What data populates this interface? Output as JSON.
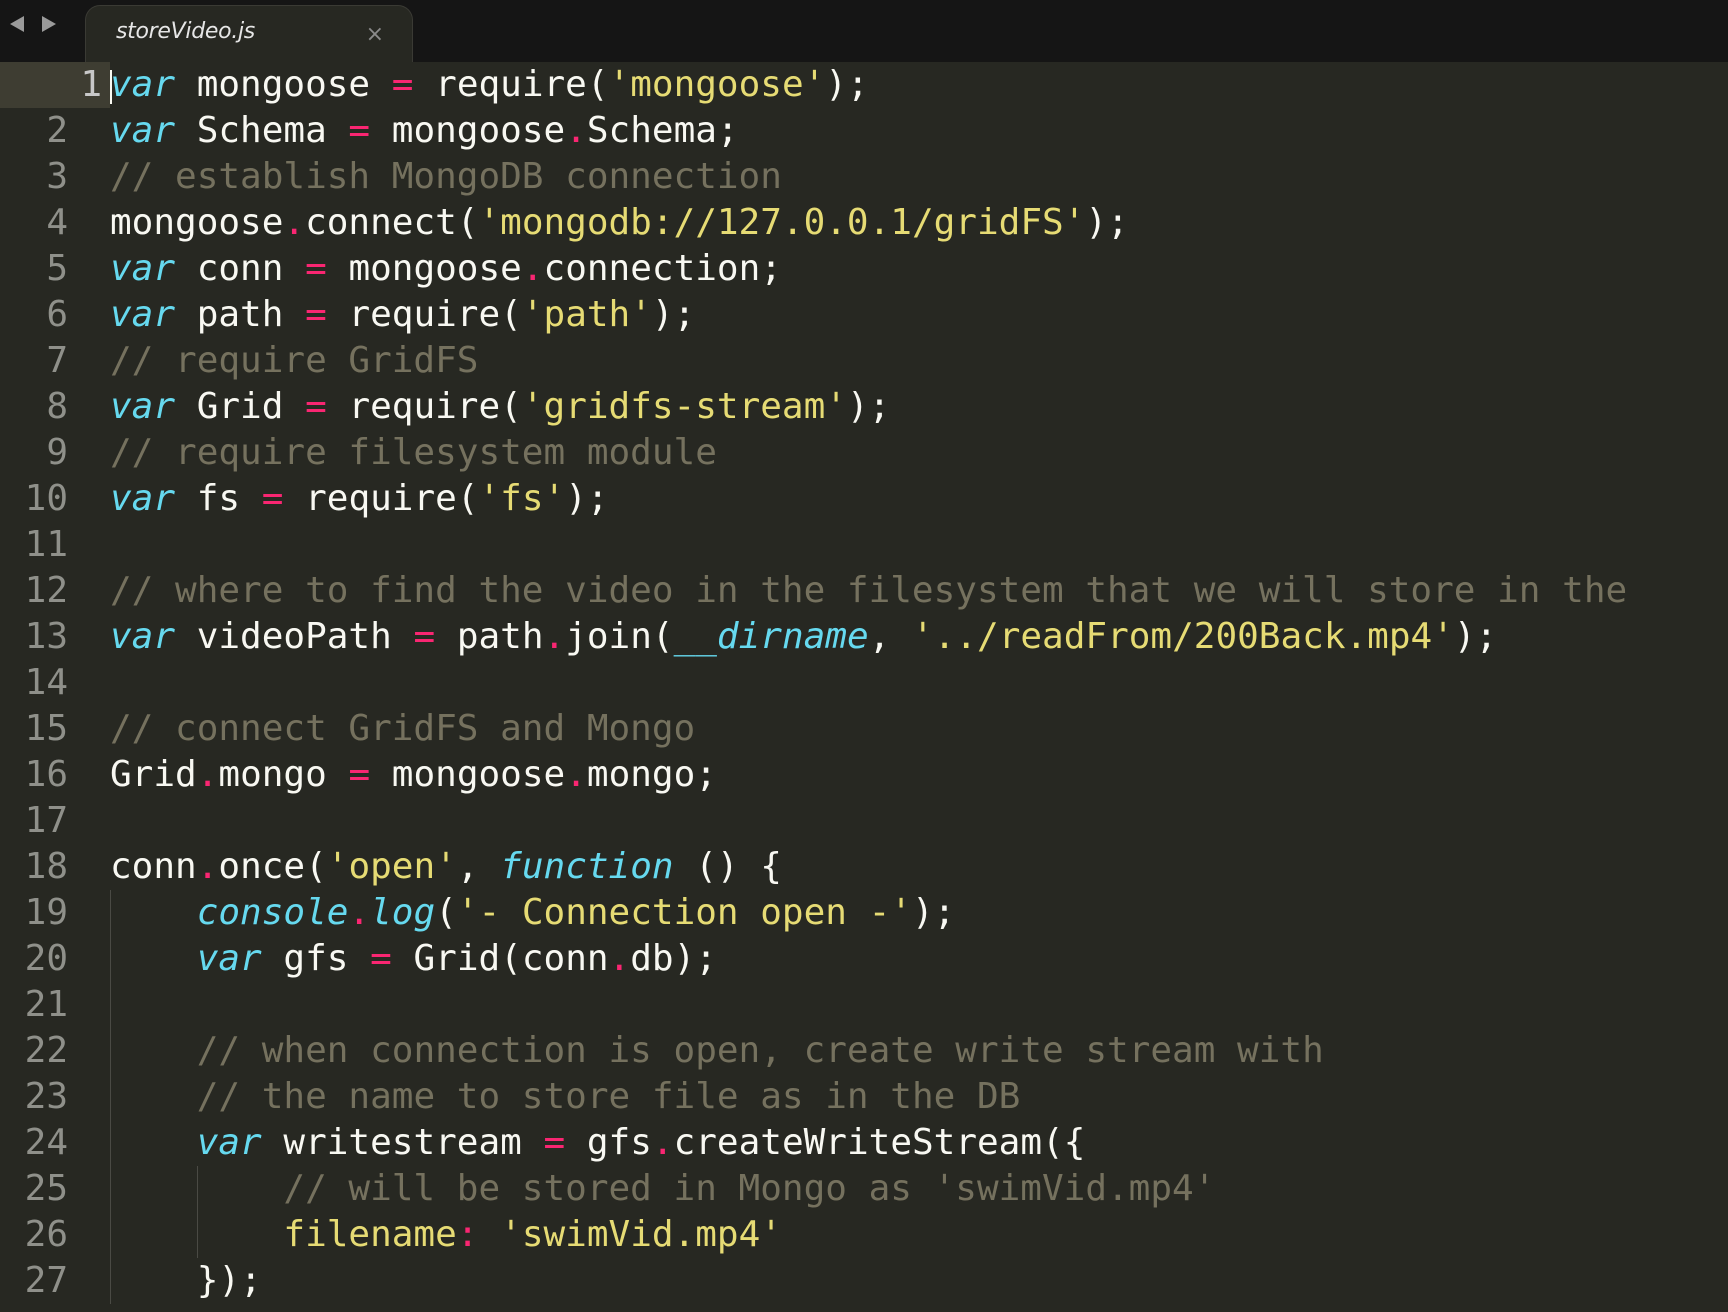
{
  "tabbar": {
    "active_tab": "storeVideo.js",
    "close_glyph": "×",
    "back_icon": "triangle-left",
    "forward_icon": "triangle-right"
  },
  "editor": {
    "current_line": 1,
    "line_numbers": [
      "1",
      "2",
      "3",
      "4",
      "5",
      "6",
      "7",
      "8",
      "9",
      "10",
      "11",
      "12",
      "13",
      "14",
      "15",
      "16",
      "17",
      "18",
      "19",
      "20",
      "21",
      "22",
      "23",
      "24",
      "25",
      "26",
      "27"
    ],
    "lines": [
      [
        {
          "t": "var",
          "c": "kw"
        },
        {
          "t": " mongoose ",
          "c": "txt"
        },
        {
          "t": "=",
          "c": "op"
        },
        {
          "t": " require(",
          "c": "txt"
        },
        {
          "t": "'mongoose'",
          "c": "str"
        },
        {
          "t": ");",
          "c": "txt"
        }
      ],
      [
        {
          "t": "var",
          "c": "kw"
        },
        {
          "t": " Schema ",
          "c": "txt"
        },
        {
          "t": "=",
          "c": "op"
        },
        {
          "t": " mongoose",
          "c": "txt"
        },
        {
          "t": ".",
          "c": "op"
        },
        {
          "t": "Schema;",
          "c": "txt"
        }
      ],
      [
        {
          "t": "// establish MongoDB connection",
          "c": "cmt"
        }
      ],
      [
        {
          "t": "mongoose",
          "c": "txt"
        },
        {
          "t": ".",
          "c": "op"
        },
        {
          "t": "connect(",
          "c": "txt"
        },
        {
          "t": "'mongodb://127.0.0.1/gridFS'",
          "c": "str"
        },
        {
          "t": ");",
          "c": "txt"
        }
      ],
      [
        {
          "t": "var",
          "c": "kw"
        },
        {
          "t": " conn ",
          "c": "txt"
        },
        {
          "t": "=",
          "c": "op"
        },
        {
          "t": " mongoose",
          "c": "txt"
        },
        {
          "t": ".",
          "c": "op"
        },
        {
          "t": "connection;",
          "c": "txt"
        }
      ],
      [
        {
          "t": "var",
          "c": "kw"
        },
        {
          "t": " path ",
          "c": "txt"
        },
        {
          "t": "=",
          "c": "op"
        },
        {
          "t": " require(",
          "c": "txt"
        },
        {
          "t": "'path'",
          "c": "str"
        },
        {
          "t": ");",
          "c": "txt"
        }
      ],
      [
        {
          "t": "// require GridFS",
          "c": "cmt"
        }
      ],
      [
        {
          "t": "var",
          "c": "kw"
        },
        {
          "t": " Grid ",
          "c": "txt"
        },
        {
          "t": "=",
          "c": "op"
        },
        {
          "t": " require(",
          "c": "txt"
        },
        {
          "t": "'gridfs-stream'",
          "c": "str"
        },
        {
          "t": ");",
          "c": "txt"
        }
      ],
      [
        {
          "t": "// require filesystem module",
          "c": "cmt"
        }
      ],
      [
        {
          "t": "var",
          "c": "kw"
        },
        {
          "t": " fs ",
          "c": "txt"
        },
        {
          "t": "=",
          "c": "op"
        },
        {
          "t": " require(",
          "c": "txt"
        },
        {
          "t": "'fs'",
          "c": "str"
        },
        {
          "t": ");",
          "c": "txt"
        }
      ],
      [],
      [
        {
          "t": "// where to find the video in the filesystem that we will store in the",
          "c": "cmt"
        }
      ],
      [
        {
          "t": "var",
          "c": "kw"
        },
        {
          "t": " videoPath ",
          "c": "txt"
        },
        {
          "t": "=",
          "c": "op"
        },
        {
          "t": " path",
          "c": "txt"
        },
        {
          "t": ".",
          "c": "op"
        },
        {
          "t": "join(",
          "c": "txt"
        },
        {
          "t": "__dirname",
          "c": "ital"
        },
        {
          "t": ", ",
          "c": "txt"
        },
        {
          "t": "'../readFrom/200Back.mp4'",
          "c": "str"
        },
        {
          "t": ");",
          "c": "txt"
        }
      ],
      [],
      [
        {
          "t": "// connect GridFS and Mongo",
          "c": "cmt"
        }
      ],
      [
        {
          "t": "Grid",
          "c": "txt"
        },
        {
          "t": ".",
          "c": "op"
        },
        {
          "t": "mongo ",
          "c": "txt"
        },
        {
          "t": "=",
          "c": "op"
        },
        {
          "t": " mongoose",
          "c": "txt"
        },
        {
          "t": ".",
          "c": "op"
        },
        {
          "t": "mongo;",
          "c": "txt"
        }
      ],
      [],
      [
        {
          "t": "conn",
          "c": "txt"
        },
        {
          "t": ".",
          "c": "op"
        },
        {
          "t": "once(",
          "c": "txt"
        },
        {
          "t": "'open'",
          "c": "str"
        },
        {
          "t": ", ",
          "c": "txt"
        },
        {
          "t": "function",
          "c": "kw"
        },
        {
          "t": " () {",
          "c": "txt"
        }
      ],
      [
        {
          "t": "    ",
          "c": "txt"
        },
        {
          "t": "console",
          "c": "ital"
        },
        {
          "t": ".",
          "c": "op"
        },
        {
          "t": "log",
          "c": "kw"
        },
        {
          "t": "(",
          "c": "txt"
        },
        {
          "t": "'- Connection open -'",
          "c": "str"
        },
        {
          "t": ");",
          "c": "txt"
        }
      ],
      [
        {
          "t": "    ",
          "c": "txt"
        },
        {
          "t": "var",
          "c": "kw"
        },
        {
          "t": " gfs ",
          "c": "txt"
        },
        {
          "t": "=",
          "c": "op"
        },
        {
          "t": " Grid(conn",
          "c": "txt"
        },
        {
          "t": ".",
          "c": "op"
        },
        {
          "t": "db);",
          "c": "txt"
        }
      ],
      [],
      [
        {
          "t": "    ",
          "c": "txt"
        },
        {
          "t": "// when connection is open, create write stream with",
          "c": "cmt"
        }
      ],
      [
        {
          "t": "    ",
          "c": "txt"
        },
        {
          "t": "// the name to store file as in the DB",
          "c": "cmt"
        }
      ],
      [
        {
          "t": "    ",
          "c": "txt"
        },
        {
          "t": "var",
          "c": "kw"
        },
        {
          "t": " writestream ",
          "c": "txt"
        },
        {
          "t": "=",
          "c": "op"
        },
        {
          "t": " gfs",
          "c": "txt"
        },
        {
          "t": ".",
          "c": "op"
        },
        {
          "t": "createWriteStream({",
          "c": "txt"
        }
      ],
      [
        {
          "t": "        ",
          "c": "txt"
        },
        {
          "t": "// will be stored in Mongo as 'swimVid.mp4'",
          "c": "cmt"
        }
      ],
      [
        {
          "t": "        ",
          "c": "txt"
        },
        {
          "t": "filename",
          "c": "prop"
        },
        {
          "t": ":",
          "c": "op"
        },
        {
          "t": " ",
          "c": "txt"
        },
        {
          "t": "'swimVid.mp4'",
          "c": "str"
        }
      ],
      [
        {
          "t": "    });",
          "c": "txt"
        }
      ]
    ]
  }
}
